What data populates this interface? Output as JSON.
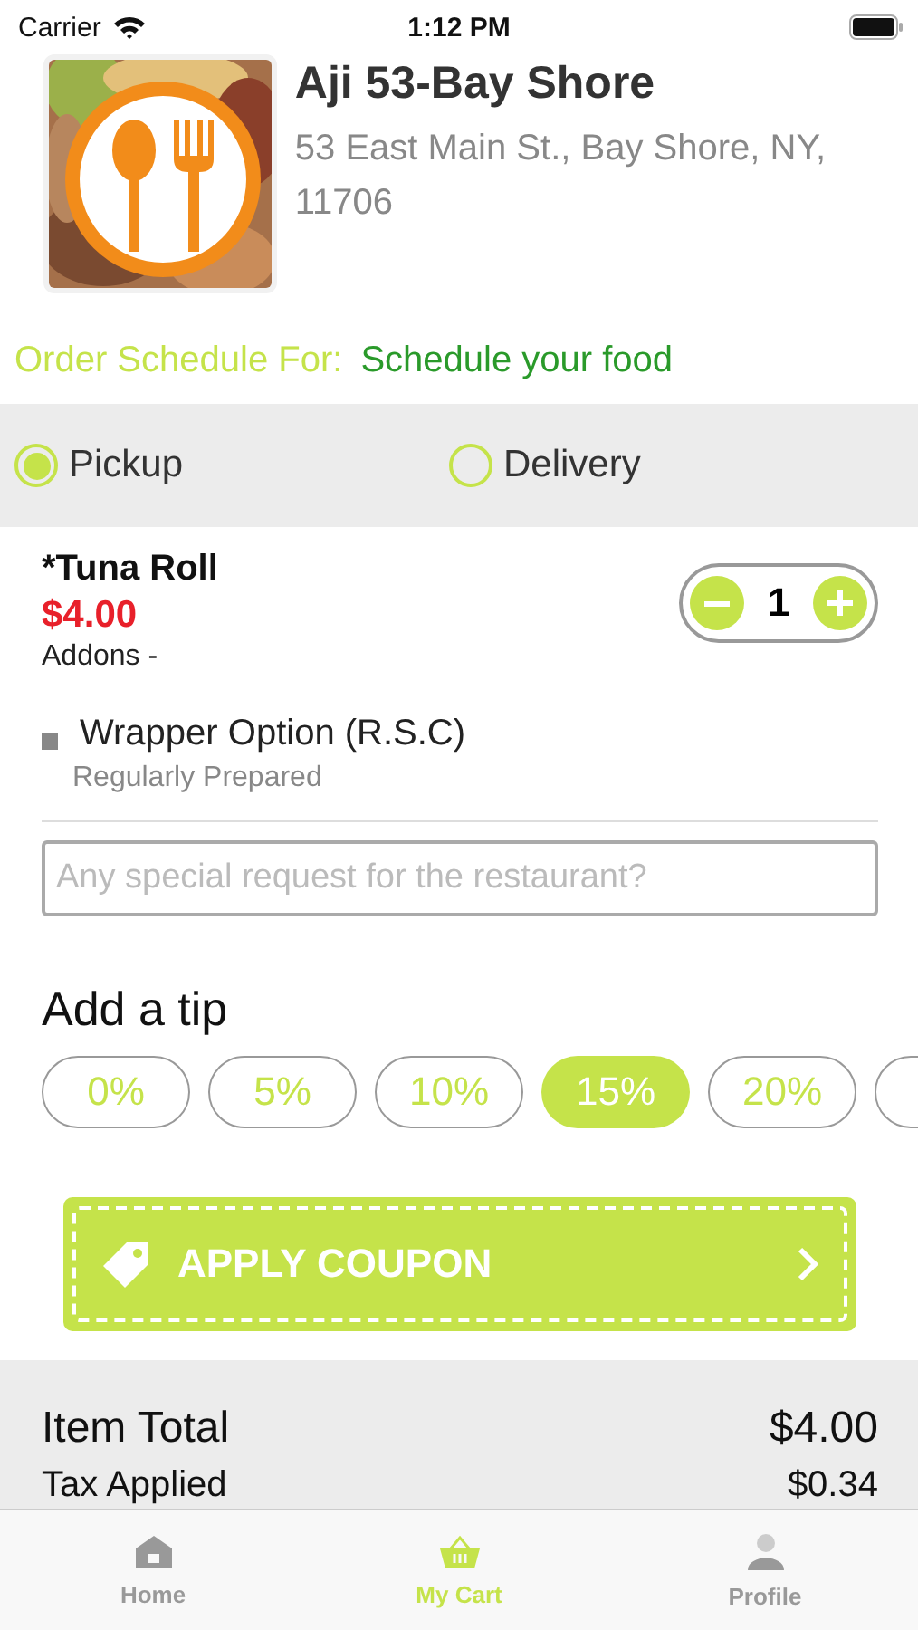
{
  "status_bar": {
    "carrier": "Carrier",
    "time": "1:12 PM"
  },
  "restaurant": {
    "name": "Aji 53-Bay Shore",
    "address": "53 East Main St., Bay Shore, NY, 11706"
  },
  "schedule": {
    "label": "Order Schedule For:",
    "value": "Schedule your food"
  },
  "order_types": [
    {
      "label": "Pickup",
      "selected": true
    },
    {
      "label": "Delivery",
      "selected": false
    }
  ],
  "item": {
    "name": "*Tuna Roll",
    "price": "$4.00",
    "addons_label": "Addons -",
    "quantity": "1",
    "addons": [
      {
        "name": "Wrapper Option (R.S.C)",
        "detail": "Regularly Prepared"
      }
    ]
  },
  "special_request": {
    "placeholder": "Any special request for the restaurant?"
  },
  "tip": {
    "title": "Add a tip",
    "options": [
      {
        "label": "0%",
        "selected": false
      },
      {
        "label": "5%",
        "selected": false
      },
      {
        "label": "10%",
        "selected": false
      },
      {
        "label": "15%",
        "selected": true
      },
      {
        "label": "20%",
        "selected": false
      }
    ]
  },
  "coupon": {
    "label": "APPLY COUPON"
  },
  "summary": [
    {
      "label": "Item Total",
      "value": "$4.00"
    },
    {
      "label": "Tax Applied",
      "value": "$0.34"
    }
  ],
  "tab_bar": [
    {
      "label": "Home",
      "selected": false
    },
    {
      "label": "My Cart",
      "selected": true
    },
    {
      "label": "Profile",
      "selected": false
    }
  ]
}
